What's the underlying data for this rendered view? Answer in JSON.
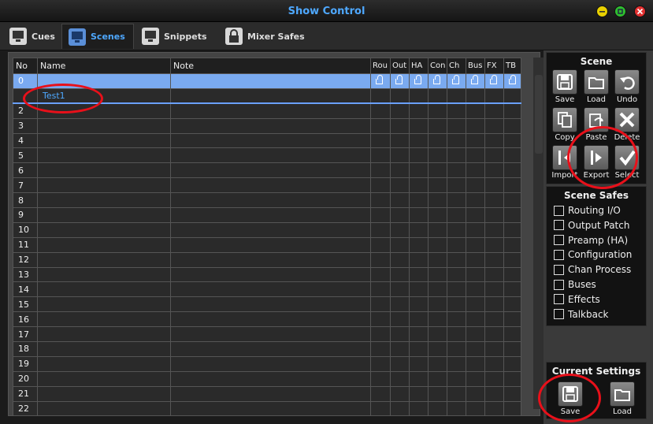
{
  "window": {
    "title": "Show Control"
  },
  "tabs": [
    {
      "label": "Cues"
    },
    {
      "label": "Scenes"
    },
    {
      "label": "Snippets"
    },
    {
      "label": "Mixer Safes"
    }
  ],
  "grid": {
    "columns": [
      "No",
      "Name",
      "Note",
      "Rou",
      "Out",
      "HA",
      "Con",
      "Ch",
      "Bus",
      "FX",
      "TB"
    ],
    "rows": [
      {
        "no": "0",
        "name": "",
        "note": ""
      },
      {
        "no": "",
        "name": "Test1",
        "note": ""
      },
      {
        "no": "2"
      },
      {
        "no": "3"
      },
      {
        "no": "4"
      },
      {
        "no": "5"
      },
      {
        "no": "6"
      },
      {
        "no": "7"
      },
      {
        "no": "8"
      },
      {
        "no": "9"
      },
      {
        "no": "10"
      },
      {
        "no": "11"
      },
      {
        "no": "12"
      },
      {
        "no": "13"
      },
      {
        "no": "14"
      },
      {
        "no": "15"
      },
      {
        "no": "16"
      },
      {
        "no": "17"
      },
      {
        "no": "18"
      },
      {
        "no": "19"
      },
      {
        "no": "20"
      },
      {
        "no": "21"
      },
      {
        "no": "22"
      }
    ]
  },
  "scene_panel": {
    "title": "Scene",
    "tools": [
      "Save",
      "Load",
      "Undo",
      "Copy",
      "Paste",
      "Delete",
      "Import",
      "Export",
      "Select"
    ]
  },
  "scene_safes": {
    "title": "Scene Safes",
    "items": [
      "Routing I/O",
      "Output Patch",
      "Preamp (HA)",
      "Configuration",
      "Chan Process",
      "Buses",
      "Effects",
      "Talkback"
    ]
  },
  "current_settings": {
    "title": "Current Settings",
    "save_label": "Save",
    "load_label": "Load"
  },
  "colors": {
    "accent": "#4ea8ff",
    "selected_row": "#7aaaf0",
    "highlight_ring": "#e8101a"
  }
}
